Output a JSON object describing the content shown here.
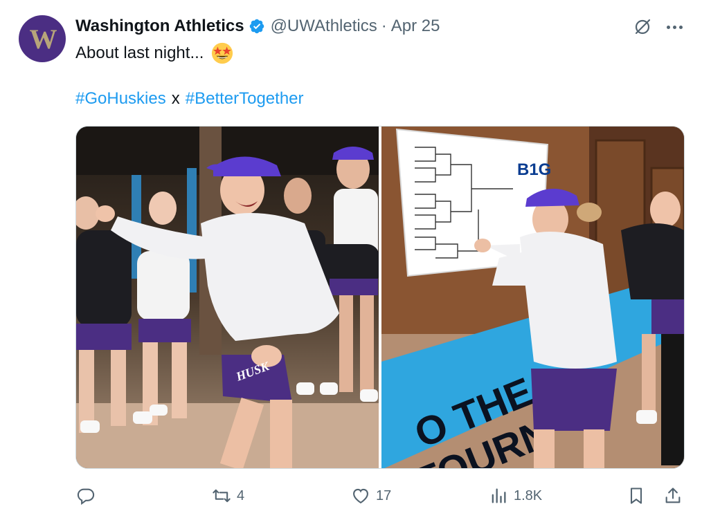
{
  "author": {
    "name": "Washington Athletics",
    "handle": "@UWAthletics",
    "separator": "·",
    "date": "Apr 25",
    "avatar_letter": "W",
    "verified": true
  },
  "tweet": {
    "text": "About last night...",
    "emoji": "star-struck-emoji",
    "hashtags": [
      "#GoHuskies",
      "#BetterTogether"
    ],
    "hashtag_separator": "x"
  },
  "media": {
    "left_photo": "team-celebration-photo",
    "right_photo": "bracket-board-photo",
    "bracket_logo": "B1G",
    "banner_text_top": "O THE",
    "banner_text_bottom": "TOURN",
    "shorts_text": "HUSK"
  },
  "actions": {
    "reply": "",
    "retweets": "4",
    "likes": "17",
    "views": "1.8K"
  },
  "colors": {
    "accent": "#1d9bf0",
    "secondary_text": "#536471",
    "primary_text": "#0f1419",
    "uw_purple": "#4b2e83",
    "uw_gold": "#b7a57a"
  }
}
